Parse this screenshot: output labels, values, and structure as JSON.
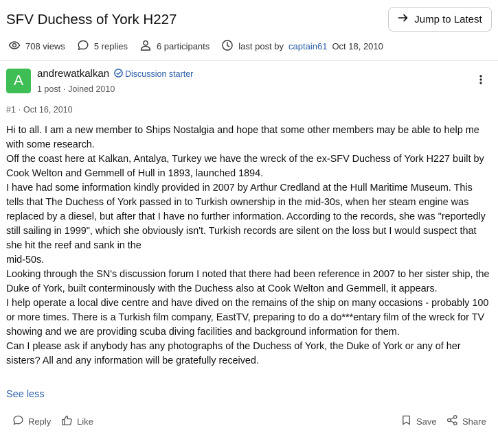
{
  "thread": {
    "title": "SFV Duchess of York H227",
    "jump_label": "Jump to Latest",
    "views": "708 views",
    "replies": "5 replies",
    "participants": "6 participants",
    "last_post_prefix": "last post by",
    "last_post_user": "captain61",
    "last_post_date": "Oct 18, 2010"
  },
  "post": {
    "avatar_letter": "A",
    "avatar_color": "#3fbe55",
    "author": "andrewatkalkan",
    "starter_badge": "Discussion starter",
    "stats": "1 post · Joined 2010",
    "number_date": "#1 · Oct 16, 2010",
    "paragraphs": [
      "Hi to all. I am a new member to Ships Nostalgia and hope that some other members may be able to help me with some research.",
      "Off the coast here at Kalkan, Antalya, Turkey we have the wreck of the ex-SFV Duchess of York H227 built by Cook Welton and Gemmell of Hull in 1893, launched 1894.",
      "I have had some information kindly provided in 2007 by Arthur Credland at the Hull Maritime Museum. This tells that The Duchess of York passed in to Turkish ownership in the mid-30s, when her steam engine was replaced by a diesel, but after that I have no further information. According to the records, she was \"reportedly still sailing in 1999\", which she obviously isn't. Turkish records are silent on the loss but I would suspect that she hit the reef and sank in the",
      "mid-50s.",
      "Looking through the SN's discussion forum I noted that there had been reference in 2007 to her sister ship, the Duke of York, built conterminously with the Duchess also at Cook Welton and Gemmell, it appears.",
      "I help operate a local dive centre and have dived on the remains of the ship on many occasions - probably 100 or more times. There is a Turkish film company, EastTV, preparing to do a do***entary film of the wreck for TV showing and we are providing scuba diving facilities and background information for them.",
      "Can I please ask if anybody has any photographs of the Duchess of York, the Duke of York or any of her sisters? All and any information will be gratefully received."
    ],
    "see_less": "See less"
  },
  "actions": {
    "reply": "Reply",
    "like": "Like",
    "save": "Save",
    "share": "Share"
  },
  "icons": {
    "arrow": "arrow-right-icon",
    "views": "eye-icon",
    "replies": "speech-bubble-icon",
    "participants": "user-icon",
    "last_post": "clock-icon",
    "starter": "check-badge-icon",
    "more": "vertical-dots-icon",
    "reply": "speech-bubble-icon",
    "like": "thumbs-up-icon",
    "save": "bookmark-icon",
    "share": "share-icon"
  },
  "colors": {
    "link": "#2b5fa8",
    "border": "#c9cbd0"
  }
}
